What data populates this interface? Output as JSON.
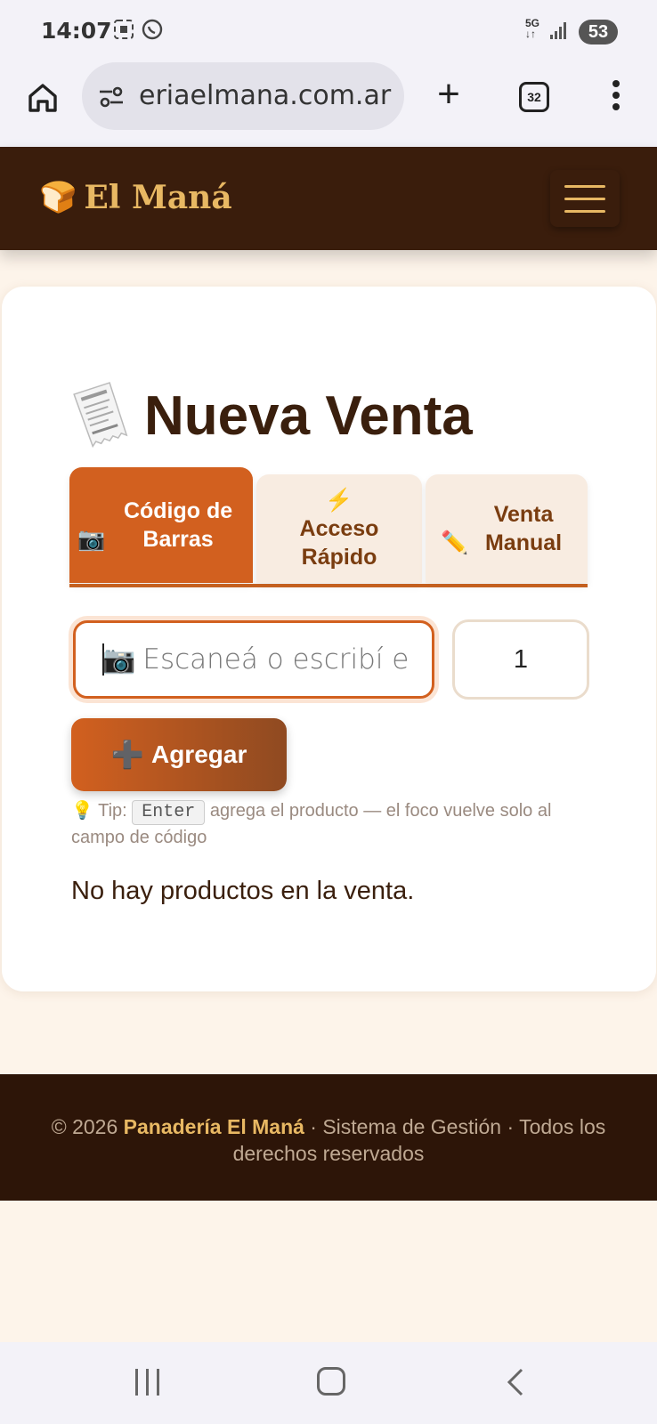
{
  "status_bar": {
    "time": "14:07",
    "network": "5G",
    "battery": "53"
  },
  "browser": {
    "url": "eriaelmana.com.ar",
    "tabs_count": "32"
  },
  "navbar": {
    "brand_icon": "🍞",
    "brand_name": "El Maná"
  },
  "page": {
    "title_icon": "🧾",
    "title": "Nueva Venta",
    "tabs": [
      {
        "icon": "📷",
        "label": "Código de Barras",
        "active": true
      },
      {
        "icon": "⚡",
        "label": "Acceso Rápido",
        "active": false
      },
      {
        "icon": "✏️",
        "label": "Venta Manual",
        "active": false
      }
    ],
    "barcode_icon": "📷",
    "barcode_placeholder": "Escaneá o escribí el código",
    "quantity_value": "1",
    "add_button_icon": "➕",
    "add_button_label": "Agregar",
    "tip_icon": "💡",
    "tip_prefix": "Tip:",
    "tip_key": "Enter",
    "tip_suffix": "agrega el producto — el foco vuelve solo al campo de código",
    "empty_message": "No hay productos en la venta."
  },
  "footer": {
    "copyright": "© 2026",
    "company": "Panadería El Maná",
    "rest": "· Sistema de Gestión · Todos los derechos reservados"
  },
  "colors": {
    "navbar_bg": "#3a1d0c",
    "brand_gold": "#e8b863",
    "accent_orange": "#d2601f",
    "page_bg": "#fdf4ea",
    "footer_bg": "#2d1508"
  }
}
